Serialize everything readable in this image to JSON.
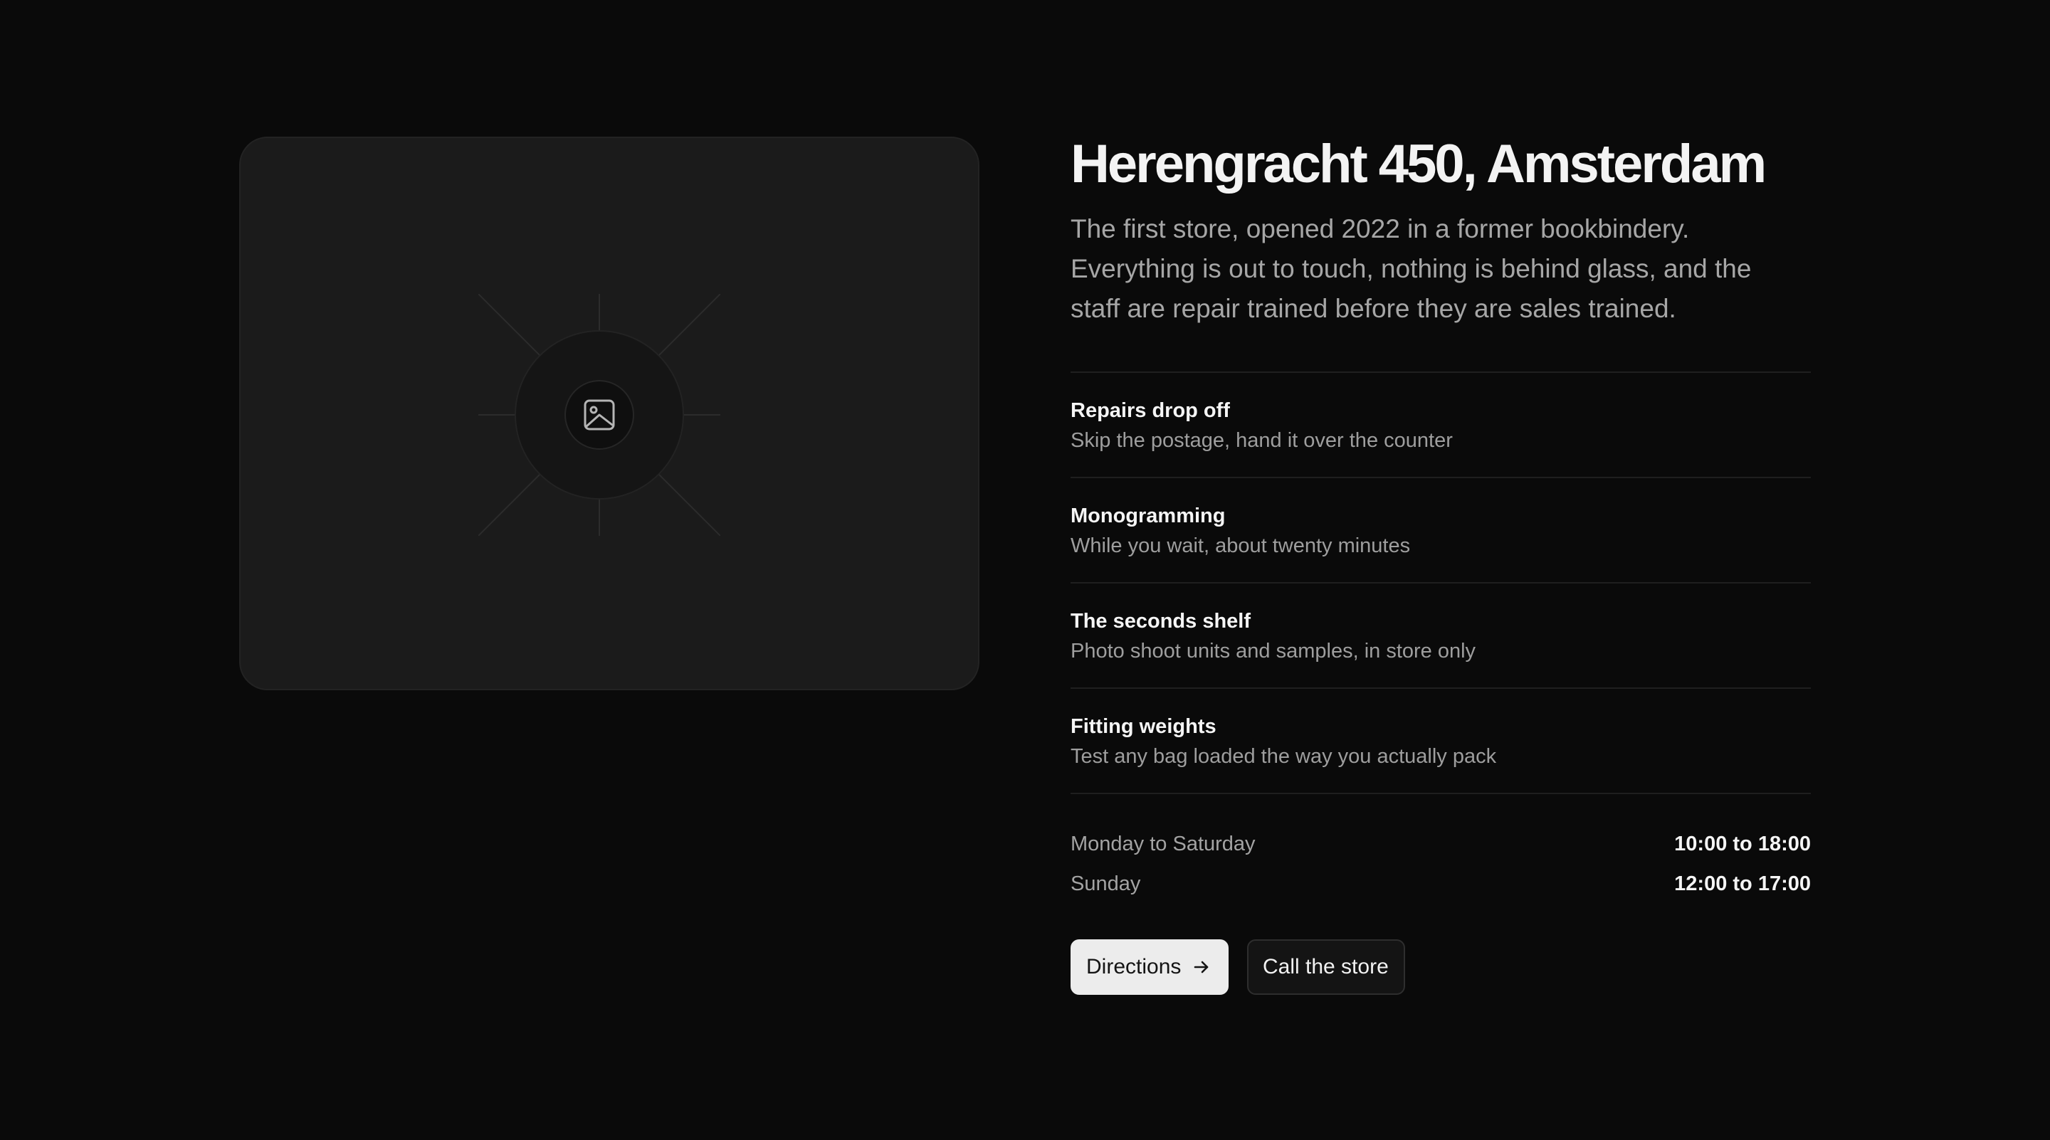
{
  "store": {
    "title": "Herengracht 450, Amsterdam",
    "intro": "The first store, opened 2022 in a former bookbindery. Everything is out to touch, nothing is behind glass, and the staff are repair trained before they are sales trained."
  },
  "features": [
    {
      "title": "Repairs drop off",
      "desc": "Skip the postage, hand it over the counter"
    },
    {
      "title": "Monogramming",
      "desc": "While you wait, about twenty minutes"
    },
    {
      "title": "The seconds shelf",
      "desc": "Photo shoot units and samples, in store only"
    },
    {
      "title": "Fitting weights",
      "desc": "Test any bag loaded the way you actually pack"
    }
  ],
  "hours": [
    {
      "day": "Monday to Saturday",
      "time": "10:00 to 18:00"
    },
    {
      "day": "Sunday",
      "time": "12:00 to 17:00"
    }
  ],
  "actions": {
    "directions_label": "Directions",
    "call_label": "Call the store"
  },
  "icons": {
    "placeholder": "image-icon",
    "directions": "arrow-right-icon"
  },
  "colors": {
    "background": "#0a0a0a",
    "card": "#1b1b1b",
    "primary_button": "#ececec"
  }
}
